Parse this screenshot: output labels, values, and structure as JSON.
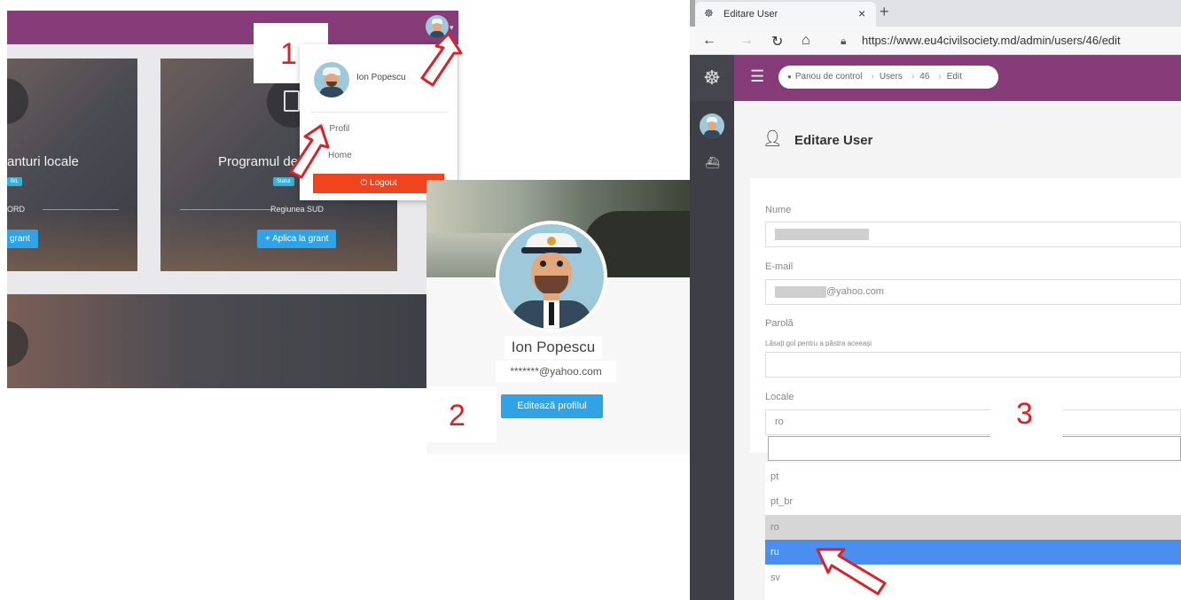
{
  "panel1": {
    "step_number": "1",
    "cards": [
      {
        "title": "anturi locale",
        "badge": "BIL",
        "region": "ORD",
        "apply_label": "grant"
      },
      {
        "title": "Programul de",
        "badge": "Statut",
        "region": "Regiunea SUD",
        "apply_label": "+ Aplica la grant"
      }
    ],
    "dropdown": {
      "user_name": "Ion Popescu",
      "items": [
        "Profil",
        "Home"
      ],
      "logout_label": "Logout"
    }
  },
  "panel2": {
    "step_number": "2",
    "user_name": "Ion Popescu",
    "email": "*******@yahoo.com",
    "edit_button": "Editează profilul"
  },
  "panel3": {
    "step_number": "3",
    "browser": {
      "tab_title": "Editare User",
      "url": "https://www.eu4civilsociety.md/admin/users/46/edit"
    },
    "breadcrumb": [
      "Panou de control",
      "Users",
      "46",
      "Edit"
    ],
    "page_title": "Editare User",
    "form": {
      "name_label": "Nume",
      "email_label": "E-mail",
      "email_suffix": "@yahoo.com",
      "password_label": "Parolă",
      "password_help": "Lăsați gol pentru a păstra aceeași",
      "locale_label": "Locale",
      "locale_value": "ro"
    },
    "locale_options": [
      "pt",
      "pt_br",
      "ro",
      "ru",
      "sv"
    ],
    "highlighted_option": "ro",
    "selected_option": "ru"
  },
  "colors": {
    "brand_purple": "#853c78",
    "sidebar_dark": "#3e3f46",
    "button_blue": "#2fa3e6",
    "logout_red": "#f1441e",
    "step_red": "#d9232a",
    "selected_blue": "#4a8ef0"
  }
}
